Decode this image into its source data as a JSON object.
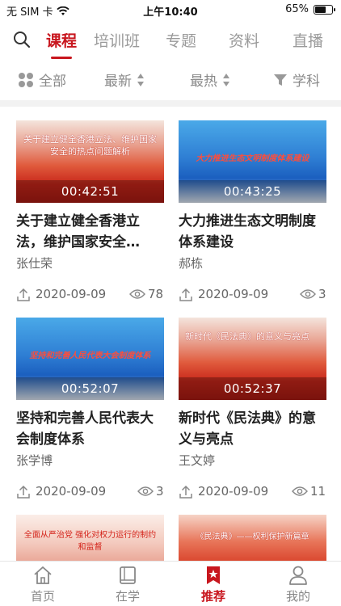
{
  "status": {
    "carrier": "无 SIM 卡",
    "time": "上午10:40",
    "battery": "65%"
  },
  "tabs": [
    {
      "label": "课程",
      "active": true
    },
    {
      "label": "培训班",
      "active": false
    },
    {
      "label": "专题",
      "active": false
    },
    {
      "label": "资料",
      "active": false
    },
    {
      "label": "直播",
      "active": false
    }
  ],
  "filters": {
    "all": "全部",
    "latest": "最新",
    "hottest": "最热",
    "subject": "学科"
  },
  "colors": {
    "accent": "#c8161e"
  },
  "courses": [
    {
      "thumb_text": "关于建立健全香港立法、维护国家安全的热点问题解析",
      "duration": "00:42:51",
      "title": "关于建立健全香港立法，维护国家安全…",
      "author": "张仕荣",
      "date": "2020-09-09",
      "views": "78"
    },
    {
      "thumb_text": "大力推进生态文明制度体系建设",
      "duration": "00:43:25",
      "title": "大力推进生态文明制度体系建设",
      "author": "郝栋",
      "date": "2020-09-09",
      "views": "3"
    },
    {
      "thumb_text": "坚持和完善人民代表大会制度体系",
      "duration": "00:52:07",
      "title": "坚持和完善人民代表大会制度体系",
      "author": "张学博",
      "date": "2020-09-09",
      "views": "3"
    },
    {
      "thumb_text": "新时代《民法典》的意义与亮点",
      "duration": "00:52:37",
      "title": "新时代《民法典》的意义与亮点",
      "author": "王文婷",
      "date": "2020-09-09",
      "views": "11"
    },
    {
      "thumb_text": "全面从严治党 强化对权力运行的制约和监督"
    },
    {
      "thumb_text": "《民法典》——权利保护新篇章"
    }
  ],
  "bottom_nav": [
    {
      "label": "首页",
      "icon": "home-icon"
    },
    {
      "label": "在学",
      "icon": "book-icon"
    },
    {
      "label": "推荐",
      "icon": "recommend-icon",
      "active": true
    },
    {
      "label": "我的",
      "icon": "user-icon"
    }
  ]
}
